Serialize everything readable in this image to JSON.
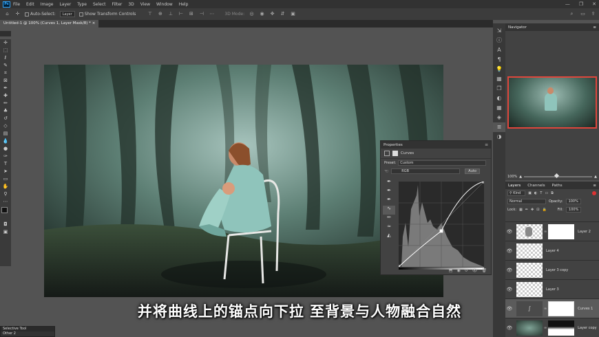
{
  "menu": {
    "logo": "Ps",
    "items": [
      "File",
      "Edit",
      "Image",
      "Layer",
      "Type",
      "Select",
      "Filter",
      "3D",
      "View",
      "Window",
      "Help"
    ],
    "window_controls": [
      "—",
      "❐",
      "✕"
    ]
  },
  "options": {
    "auto_select": "Auto-Select:",
    "auto_select_value": "Layer",
    "show_transform": "Show Transform Controls",
    "mode_3d": "3D Mode:"
  },
  "document": {
    "tab_title": "Untitled-1 @ 100% (Curves 1, Layer Mask/8) *"
  },
  "properties": {
    "title": "Properties",
    "adjustment": "Curves",
    "preset_label": "Preset:",
    "preset_value": "Custom",
    "channel": "RGB",
    "auto_button": "Auto",
    "curve_points": [
      [
        0,
        0
      ],
      [
        0.5,
        0.42
      ],
      [
        1,
        1
      ]
    ]
  },
  "navigator": {
    "title": "Navigator",
    "zoom": "100%"
  },
  "layers": {
    "tabs": [
      "Layers",
      "Channels",
      "Paths"
    ],
    "kind": "Kind",
    "blend_mode": "Normal",
    "opacity_label": "Opacity:",
    "opacity_value": "100%",
    "lock_label": "Lock:",
    "fill_label": "Fill:",
    "fill_value": "100%",
    "rows": [
      {
        "name": "Layer 2"
      },
      {
        "name": "Layer 4"
      },
      {
        "name": "Layer 3 copy"
      },
      {
        "name": "Layer 3"
      },
      {
        "name": "Curves 1"
      },
      {
        "name": "Layer copy"
      }
    ]
  },
  "selective_tool": {
    "title": "Selective Tool",
    "item": "Other 2"
  },
  "caption": "并将曲线上的锚点向下拉 至背景与人物融合自然",
  "colors": {
    "accent": "#31a8ff",
    "nav_frame": "#e0463c",
    "panel": "#424242",
    "ui_bg": "#535353"
  }
}
